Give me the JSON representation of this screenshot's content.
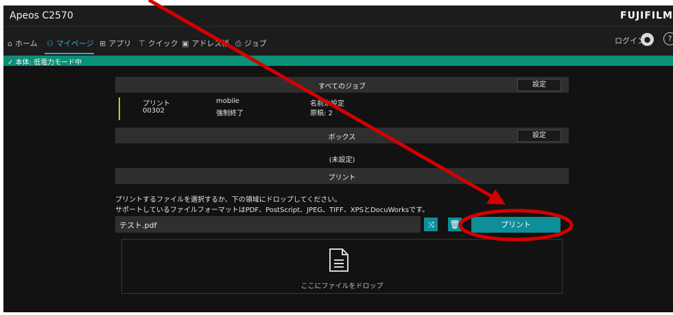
{
  "app": {
    "title": "Apeos C2570",
    "brand": "FUJIFILM"
  },
  "nav": {
    "items": [
      {
        "label": "ホーム",
        "icon": "home-icon"
      },
      {
        "label": "マイページ",
        "icon": "user-icon",
        "active": true
      },
      {
        "label": "アプリ",
        "icon": "grid-icon"
      },
      {
        "label": "クイック",
        "icon": "quick-icon"
      },
      {
        "label": "アドレス帳",
        "icon": "address-book-icon"
      },
      {
        "label": "ジョブ",
        "icon": "job-icon"
      }
    ],
    "login_label": "ログイン"
  },
  "status": {
    "text": "✓ 本体: 低電力モード中"
  },
  "all_jobs": {
    "title": "すべてのジョブ",
    "settings_label": "設定",
    "job": {
      "type": "プリント",
      "number": "00302",
      "user": "mobile",
      "state": "強制終了",
      "name": "名前未設定",
      "pages": "原稿: 2"
    }
  },
  "box": {
    "title": "ボックス",
    "settings_label": "設定",
    "value": "(未設定)"
  },
  "print": {
    "title": "プリント",
    "instruction": "プリントするファイルを選択するか、下の領域にドロップしてください。",
    "formats": "サポートしているファイルフォーマットはPDF、PostScript、JPEG、TIFF、XPSとDocuWorksです。",
    "file_name": "テスト.pdf",
    "button_label": "プリント",
    "drop_text": "ここにファイルをドロップ"
  },
  "colors": {
    "accent": "#25b3d3",
    "status_green": "#0b8f77",
    "button_teal": "#0e8e98",
    "annotation_red": "#d40000"
  }
}
